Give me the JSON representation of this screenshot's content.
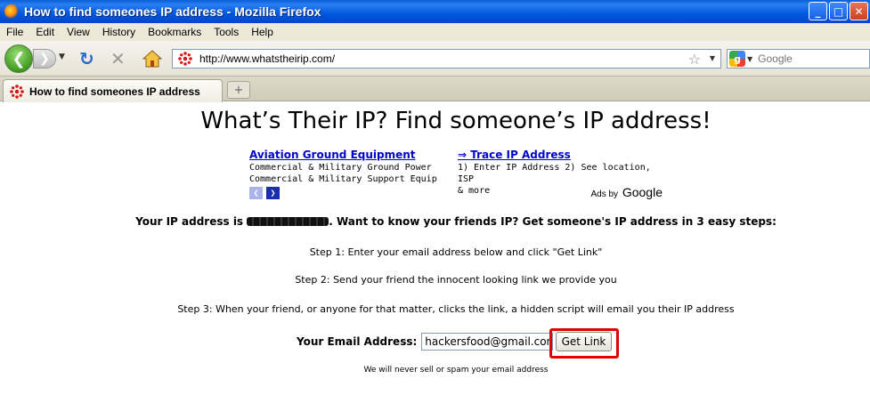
{
  "window": {
    "title": "How to find someones IP address - Mozilla Firefox",
    "buttons": {
      "minimize": "_",
      "maximize": "□",
      "close": "✕"
    }
  },
  "menu": [
    "File",
    "Edit",
    "View",
    "History",
    "Bookmarks",
    "Tools",
    "Help"
  ],
  "toolbar": {
    "url": "http://www.whatstheirip.com/",
    "search_placeholder": "Google"
  },
  "tab": {
    "title": "How to find someones IP address",
    "new_tab_symbol": "+"
  },
  "page": {
    "headline": "What’s Their IP? Find someone’s IP address!",
    "ads": [
      {
        "title": "Aviation Ground Equipment",
        "lines": [
          "Commercial & Military Ground Power",
          "Commercial & Military Support Equip"
        ]
      },
      {
        "title": "⇒ Trace IP Address",
        "lines": [
          "1) Enter IP Address 2) See location, ISP",
          "& more"
        ]
      }
    ],
    "ads_by": "Ads by",
    "ads_brand": "Google",
    "ip_prefix": "Your IP address is",
    "ip_suffix": ". Want to know your friends IP? Get someone's IP address in 3 easy steps:",
    "step1": "Step 1: Enter your email address below and click \"Get Link\"",
    "step2": "Step 2: Send your friend the innocent looking link we provide you",
    "step3": "Step 3: When your friend, or anyone for that matter, clicks the link, a hidden script will email you their IP address",
    "email_label": "Your Email Address:",
    "email_value": "hackersfood@gmail.com",
    "get_link": "Get Link",
    "privacy": "We will never sell or spam your email address"
  },
  "colors": {
    "highlight": "#e00000",
    "ad_link": "#0000cc",
    "titlebar": "#0058e0"
  }
}
